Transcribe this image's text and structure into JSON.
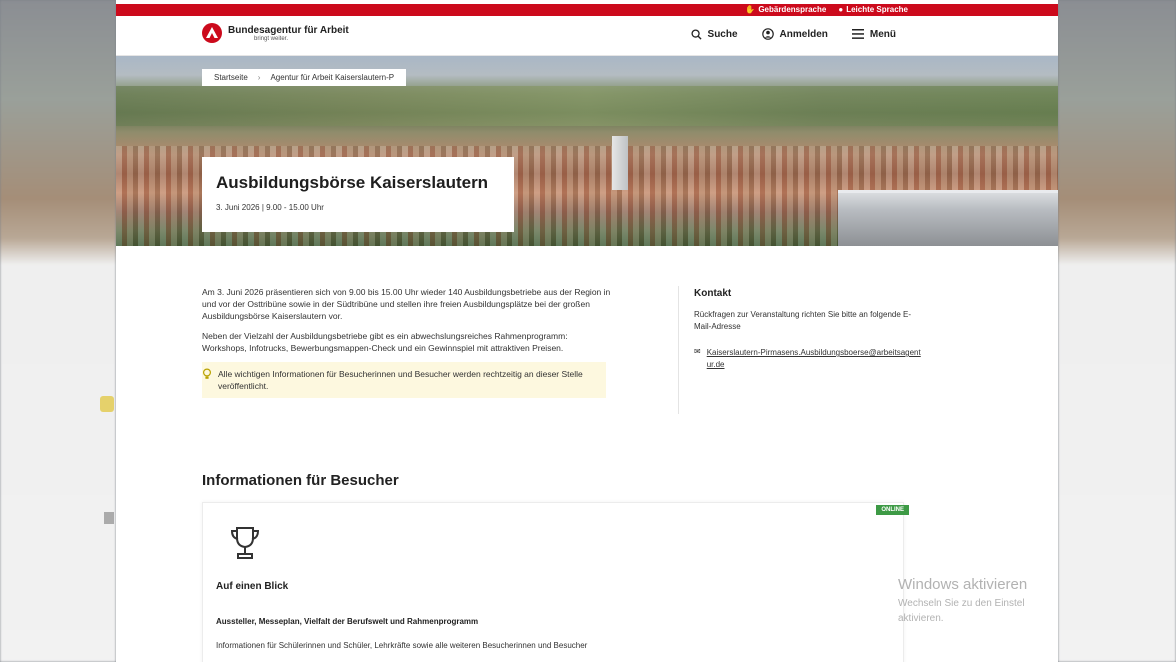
{
  "topbar": {
    "link1": "Gebärdensprache",
    "link2": "Leichte Sprache"
  },
  "header": {
    "logo_name": "Bundesagentur für Arbeit",
    "logo_tagline": "bringt weiter.",
    "nav": {
      "search": "Suche",
      "login": "Anmelden",
      "menu": "Menü"
    }
  },
  "breadcrumb": {
    "item1": "Startseite",
    "item2": "Agentur für Arbeit Kaiserslautern-P"
  },
  "hero": {
    "title": "Ausbildungsbörse Kaiserslautern",
    "date": "3. Juni 2026 | 9.00 - 15.00 Uhr"
  },
  "content": {
    "para1": "Am 3. Juni 2026 präsentieren sich von 9.00 bis 15.00 Uhr wieder 140 Ausbildungsbetriebe aus der Region in und vor der Osttribüne sowie in der Südtribüne und stellen ihre freien Ausbildungsplätze bei der großen Ausbildungsbörse Kaiserslautern vor.",
    "para2": "Neben der Vielzahl der Ausbildungsbetriebe gibt es ein abwechslungsreiches Rahmenprogramm: Workshops, Infotrucks, Bewerbungsmappen-Check und ein Gewinnspiel mit attraktiven Preisen.",
    "hint": "Alle wichtigen Informationen für Besucherinnen und Besucher werden rechtzeitig an dieser Stelle veröffentlicht."
  },
  "contact": {
    "heading": "Kontakt",
    "text": "Rückfragen zur Veranstaltung richten Sie bitte an folgende E-Mail-Adresse",
    "email": "Kaiserslautern-Pirmasens.Ausbildungsboerse@arbeitsagentur.de"
  },
  "section": {
    "title": "Informationen für Besucher"
  },
  "card": {
    "badge": "ONLINE",
    "title": "Auf einen Blick",
    "subtitle": "Aussteller, Messeplan, Vielfalt der Berufswelt und Rahmenprogramm",
    "desc": "Informationen für Schülerinnen und Schüler, Lehrkräfte sowie alle weiteren Besucherinnen und Besucher"
  },
  "watermark": {
    "line1": "Windows aktivieren",
    "line2": "Wechseln Sie zu den Einstel",
    "line3": "aktivieren."
  },
  "colors": {
    "brand_red": "#cc0a1c",
    "badge_green": "#3d9a45",
    "hint_bg": "#fdf8df"
  }
}
